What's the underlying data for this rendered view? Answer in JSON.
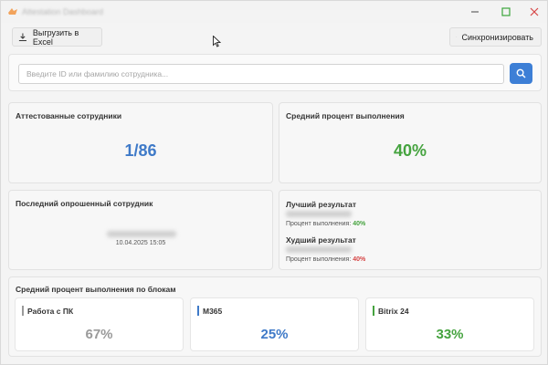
{
  "window": {
    "title": "Attestation Dashboard",
    "controls": {
      "minimize": "minimize-icon",
      "maximize": "maximize-icon",
      "close": "close-icon"
    }
  },
  "toolbar": {
    "export_label": "Выгрузить в Excel",
    "export_icon": "download-icon",
    "sync_label": "Синхронизировать",
    "sync_icon": "refresh-icon"
  },
  "search": {
    "placeholder": "Введите ID или фамилию сотрудника...",
    "value": "",
    "button_icon": "search-icon"
  },
  "certified": {
    "title": "Аттестованные сотрудники",
    "value": "1/86",
    "color": "#3f7ac8"
  },
  "average": {
    "title": "Средний процент выполнения",
    "value": "40%",
    "color": "#45a33f"
  },
  "last_employee": {
    "title": "Последний опрошенный сотрудник",
    "datetime": "10.04.2025 15:05"
  },
  "results": {
    "best_title": "Лучший результат",
    "best_label": "Процент выполнения:",
    "best_value": "40%",
    "best_color": "#45a33f",
    "worst_title": "Худший результат",
    "worst_label": "Процент выполнения:",
    "worst_value": "40%",
    "worst_color": "#d64545"
  },
  "blocks": {
    "title": "Средний процент выполнения по блокам",
    "items": [
      {
        "label": "Работа с ПК",
        "value": "67%",
        "color": "#9a9a9a"
      },
      {
        "label": "M365",
        "value": "25%",
        "color": "#3f7ac8"
      },
      {
        "label": "Bitrix 24",
        "value": "33%",
        "color": "#45a33f"
      }
    ]
  }
}
